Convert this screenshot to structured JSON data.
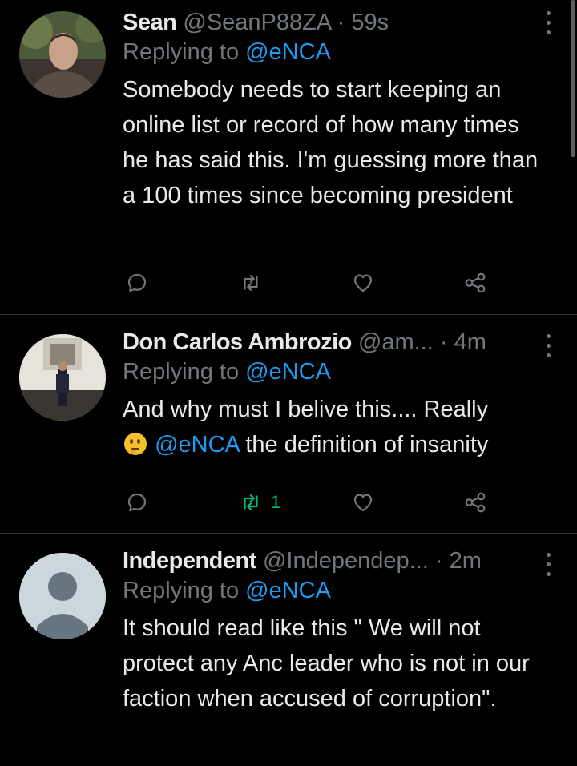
{
  "tweets": [
    {
      "name": "Sean",
      "handle": "@SeanP88ZA",
      "time": "59s",
      "reply_prefix": "Replying to",
      "reply_to": "@eNCA",
      "text": "Somebody needs to start keeping an online list or record of how many times he has said this. I'm guessing more than a 100 times since becoming president",
      "retweet_count": ""
    },
    {
      "name": "Don Carlos Ambrozio",
      "handle": "@am...",
      "time": "4m",
      "reply_prefix": "Replying to",
      "reply_to": "@eNCA",
      "text_part1": "And why must I belive this.... Really",
      "emoji": "🤔",
      "mention": "@eNCA",
      "text_part2": "the definition of insanity",
      "retweet_count": "1"
    },
    {
      "name": "Independent",
      "handle": "@Independep...",
      "time": "2m",
      "reply_prefix": "Replying to",
      "reply_to": "@eNCA",
      "text": "It should read like this \" We will not protect any Anc leader who is not in our faction when accused of corruption\"."
    }
  ],
  "separator": "·",
  "colors": {
    "background": "#000000",
    "text": "#e7e9ea",
    "muted": "#71767b",
    "accent": "#1d9bf0",
    "retweeted": "#00ba7c",
    "divider": "#2f3336"
  },
  "icons": [
    "reply-icon",
    "retweet-icon",
    "like-icon",
    "share-icon",
    "more-icon"
  ]
}
